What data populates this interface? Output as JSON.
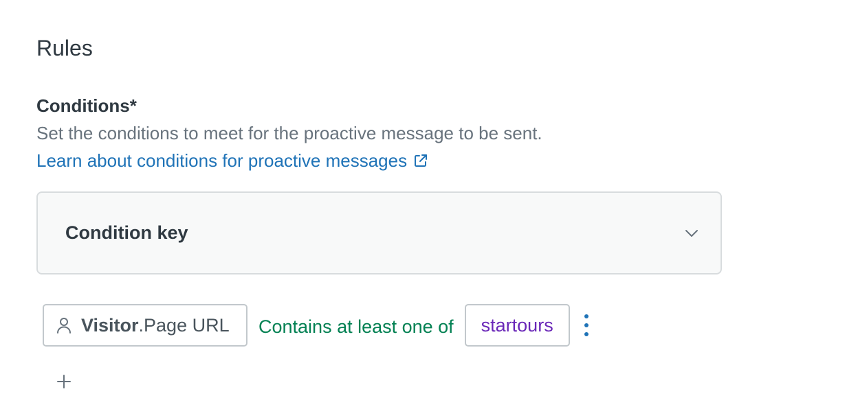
{
  "section": {
    "title": "Rules"
  },
  "conditions": {
    "label": "Conditions*",
    "hint": "Set the conditions to meet for the proactive message to be sent.",
    "link_text": "Learn about conditions for proactive messages",
    "link_icon": "external-link-icon"
  },
  "accordion": {
    "title": "Condition key",
    "icon": "chevron-down-icon"
  },
  "condition": {
    "key_icon": "user-icon",
    "key_entity": "Visitor",
    "key_field": ".Page URL",
    "operator": "Contains at least one of",
    "value": "startours",
    "menu_icon": "kebab-menu-icon"
  },
  "add": {
    "icon": "plus-icon"
  },
  "colors": {
    "text_primary": "#2f3941",
    "text_hint": "#68737d",
    "link": "#1f73b7",
    "operator": "#038153",
    "value": "#6a27b8",
    "border": "#d8dcde",
    "panel_bg": "#f8f9f9"
  }
}
